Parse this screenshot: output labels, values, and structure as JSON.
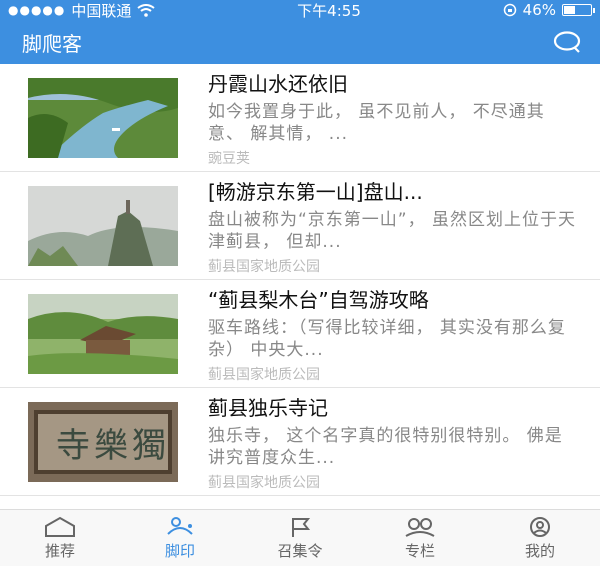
{
  "status": {
    "carrier": "中国联通",
    "time": "下午4:55",
    "battery": "46%",
    "battery_level": 0.46
  },
  "header": {
    "title": "脚爬客"
  },
  "items": [
    {
      "title": "丹霞山水还依旧",
      "desc": "如今我置身于此， 虽不见前人， 不尽通其意、 解其情， ...",
      "source": "豌豆荚"
    },
    {
      "title": "[畅游京东第一山]盘山...",
      "desc": "盘山被称为“京东第一山”， 虽然区划上位于天津蓟县， 但却...",
      "source": "蓟县国家地质公园"
    },
    {
      "title": "“蓟县梨木台”自驾游攻略",
      "desc": "驱车路线：（写得比较详细， 其实没有那么复杂） 中央大...",
      "source": "蓟县国家地质公园"
    },
    {
      "title": "蓟县独乐寺记",
      "desc": "独乐寺， 这个名字真的很特别很特别。 佛是讲究普度众生...",
      "source": "蓟县国家地质公园"
    }
  ],
  "tabs": [
    {
      "label": "推荐",
      "icon": "home-icon",
      "active": false
    },
    {
      "label": "脚印",
      "icon": "footprint-icon",
      "active": true
    },
    {
      "label": "召集令",
      "icon": "flag-icon",
      "active": false
    },
    {
      "label": "专栏",
      "icon": "group-icon",
      "active": false
    },
    {
      "label": "我的",
      "icon": "profile-icon",
      "active": false
    }
  ],
  "colors": {
    "brand": "#3d8fe0"
  }
}
